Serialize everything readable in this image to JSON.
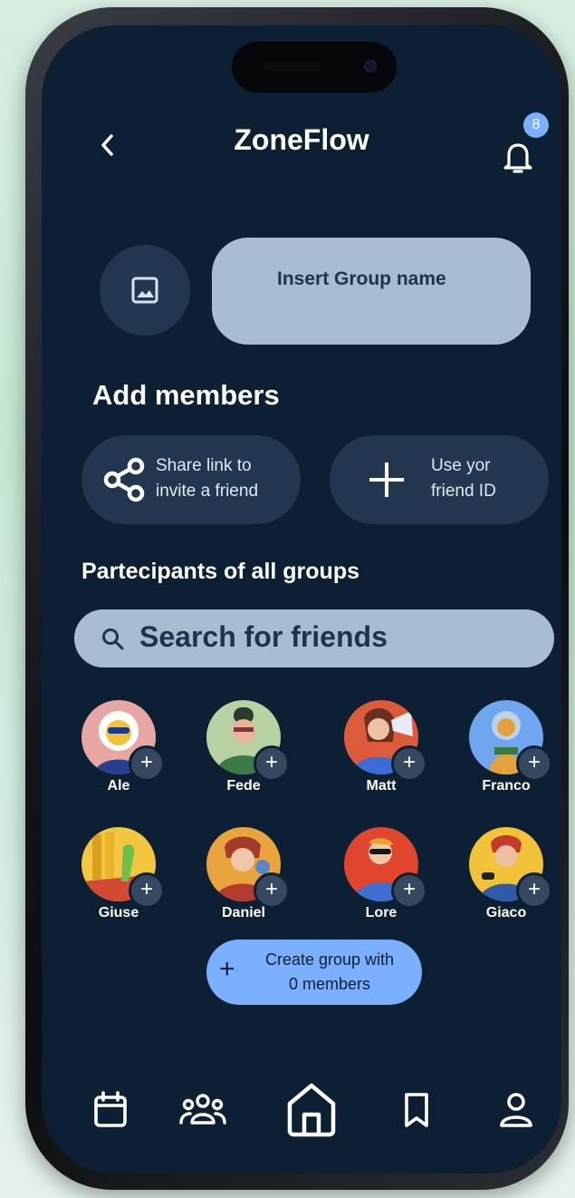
{
  "header": {
    "title": "ZoneFlow",
    "notification_count": "8"
  },
  "group": {
    "name_placeholder": "Insert Group name"
  },
  "add_members": {
    "heading": "Add members",
    "share_label": "Share link to invite a friend",
    "friend_id_label": "Use yor friend ID"
  },
  "participants": {
    "heading": "Partecipants of all groups",
    "search_placeholder": "Search for friends",
    "friends": [
      {
        "name": "Ale"
      },
      {
        "name": "Fede"
      },
      {
        "name": "Matt"
      },
      {
        "name": "Franco"
      },
      {
        "name": "Giuse"
      },
      {
        "name": "Daniel"
      },
      {
        "name": "Lore"
      },
      {
        "name": "Giaco"
      }
    ]
  },
  "create_button": {
    "label_line1": "Create group with",
    "label_line2": "0  members",
    "plus": "+"
  },
  "add_badge": "+",
  "bottom_nav": [
    "calendar-icon",
    "people-icon",
    "home-icon",
    "bookmark-icon",
    "profile-icon"
  ],
  "colors": {
    "screen_bg": "#0d1f33",
    "card_dark": "#223650",
    "card_light": "#a8bdd0",
    "accent": "#7ab0ff"
  }
}
